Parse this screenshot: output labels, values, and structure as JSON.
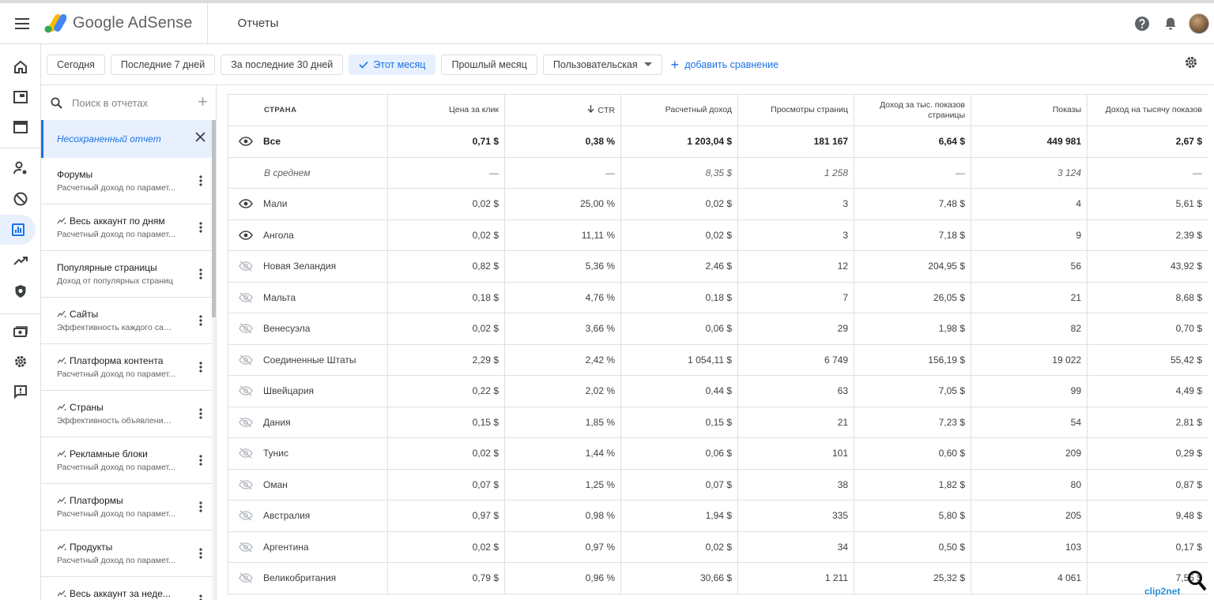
{
  "app": {
    "brand_name": "Google AdSense",
    "page_title": "Отчеты",
    "brand_colors": [
      "#fbbc04",
      "#34a853",
      "#4285f4"
    ]
  },
  "date_filters": [
    {
      "label": "Сегодня",
      "selected": false
    },
    {
      "label": "Последние 7 дней",
      "selected": false
    },
    {
      "label": "За последние 30 дней",
      "selected": false
    },
    {
      "label": "Этот месяц",
      "selected": true
    },
    {
      "label": "Прошлый месяц",
      "selected": false
    },
    {
      "label": "Пользовательская",
      "selected": false,
      "dropdown": true
    }
  ],
  "add_compare_label": "добавить сравнение",
  "search": {
    "placeholder": "Поиск в отчетах"
  },
  "unsaved_report": "Несохраненный отчет",
  "reports": [
    {
      "title": "Форумы",
      "subtitle": "Расчетный доход по парамет...",
      "spark": false
    },
    {
      "title": "Весь аккаунт по дням",
      "subtitle": "Расчетный доход по парамет...",
      "spark": true
    },
    {
      "title": "Популярные страницы",
      "subtitle": "Доход от популярных страниц",
      "spark": false
    },
    {
      "title": "Сайты",
      "subtitle": "Эффективность каждого сайта",
      "spark": true
    },
    {
      "title": "Платформа контента",
      "subtitle": "Расчетный доход по парамет...",
      "spark": true
    },
    {
      "title": "Страны",
      "subtitle": "Эффективность объявлений ...",
      "spark": true
    },
    {
      "title": "Рекламные блоки",
      "subtitle": "Расчетный доход по парамет...",
      "spark": true
    },
    {
      "title": "Платформы",
      "subtitle": "Расчетный доход по парамет...",
      "spark": true
    },
    {
      "title": "Продукты",
      "subtitle": "Расчетный доход по парамет...",
      "spark": true
    },
    {
      "title": "Весь аккаунт за неде...",
      "subtitle": "",
      "spark": true
    }
  ],
  "table": {
    "columns": [
      "СТРАНА",
      "Цена за клик",
      "CTR",
      "Расчетный доход",
      "Просмотры страниц",
      "Доход за тыс. показов страницы",
      "Показы",
      "Доход на тысячу показов"
    ],
    "sorted_column": "CTR",
    "total": {
      "label": "Все",
      "values": [
        "0,71 $",
        "0,38 %",
        "1 203,04 $",
        "181 167",
        "6,64 $",
        "449 981",
        "2,67 $"
      ]
    },
    "average": {
      "label": "В среднем",
      "values": [
        "—",
        "—",
        "8,35 $",
        "1 258",
        "—",
        "3 124",
        "—"
      ]
    },
    "rows": [
      {
        "country": "Мали",
        "visible": true,
        "values": [
          "0,02 $",
          "25,00 %",
          "0,02 $",
          "3",
          "7,48 $",
          "4",
          "5,61 $"
        ]
      },
      {
        "country": "Ангола",
        "visible": true,
        "values": [
          "0,02 $",
          "11,11 %",
          "0,02 $",
          "3",
          "7,18 $",
          "9",
          "2,39 $"
        ]
      },
      {
        "country": "Новая Зеландия",
        "visible": false,
        "values": [
          "0,82 $",
          "5,36 %",
          "2,46 $",
          "12",
          "204,95 $",
          "56",
          "43,92 $"
        ]
      },
      {
        "country": "Мальта",
        "visible": false,
        "values": [
          "0,18 $",
          "4,76 %",
          "0,18 $",
          "7",
          "26,05 $",
          "21",
          "8,68 $"
        ]
      },
      {
        "country": "Венесуэла",
        "visible": false,
        "values": [
          "0,02 $",
          "3,66 %",
          "0,06 $",
          "29",
          "1,98 $",
          "82",
          "0,70 $"
        ]
      },
      {
        "country": "Соединенные Штаты",
        "visible": false,
        "values": [
          "2,29 $",
          "2,42 %",
          "1 054,11 $",
          "6 749",
          "156,19 $",
          "19 022",
          "55,42 $"
        ]
      },
      {
        "country": "Швейцария",
        "visible": false,
        "values": [
          "0,22 $",
          "2,02 %",
          "0,44 $",
          "63",
          "7,05 $",
          "99",
          "4,49 $"
        ]
      },
      {
        "country": "Дания",
        "visible": false,
        "values": [
          "0,15 $",
          "1,85 %",
          "0,15 $",
          "21",
          "7,23 $",
          "54",
          "2,81 $"
        ]
      },
      {
        "country": "Тунис",
        "visible": false,
        "values": [
          "0,02 $",
          "1,44 %",
          "0,06 $",
          "101",
          "0,60 $",
          "209",
          "0,29 $"
        ]
      },
      {
        "country": "Оман",
        "visible": false,
        "values": [
          "0,07 $",
          "1,25 %",
          "0,07 $",
          "38",
          "1,82 $",
          "80",
          "0,87 $"
        ]
      },
      {
        "country": "Австралия",
        "visible": false,
        "values": [
          "0,97 $",
          "0,98 %",
          "1,94 $",
          "335",
          "5,80 $",
          "205",
          "9,48 $"
        ]
      },
      {
        "country": "Аргентина",
        "visible": false,
        "values": [
          "0,02 $",
          "0,97 %",
          "0,02 $",
          "34",
          "0,50 $",
          "103",
          "0,17 $"
        ]
      },
      {
        "country": "Великобритания",
        "visible": false,
        "values": [
          "0,79 $",
          "0,96 %",
          "30,66 $",
          "1 211",
          "25,32 $",
          "4 061",
          "7,55 $"
        ]
      }
    ]
  },
  "watermark": "clip2net"
}
